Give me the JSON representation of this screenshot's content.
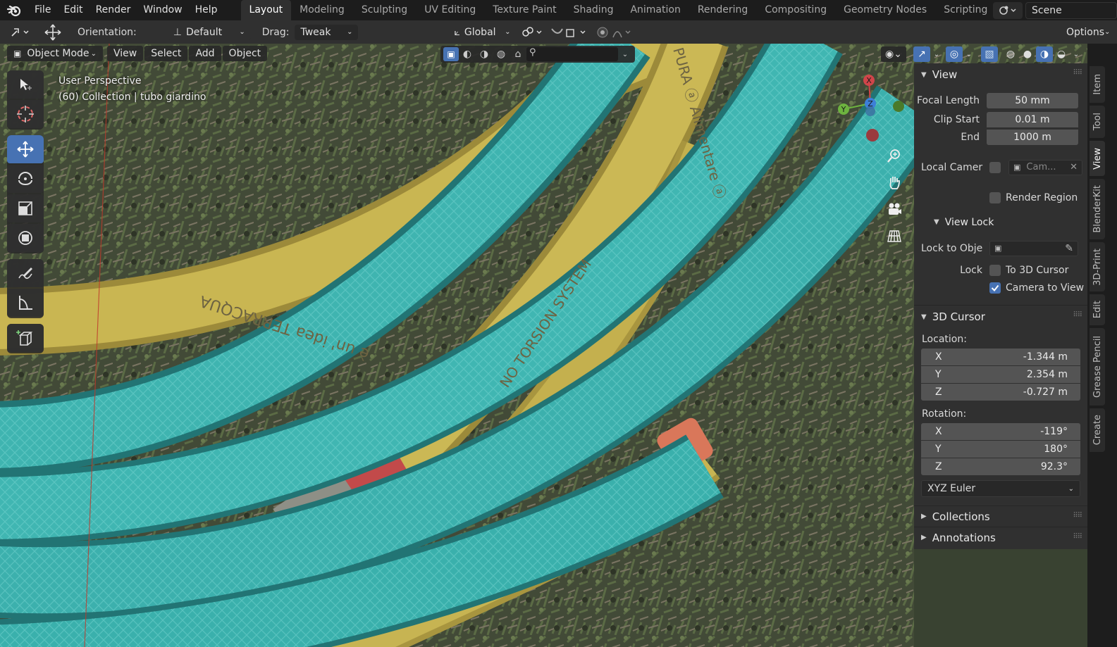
{
  "menu": [
    "File",
    "Edit",
    "Render",
    "Window",
    "Help"
  ],
  "workspaces": [
    "Layout",
    "Modeling",
    "Sculpting",
    "UV Editing",
    "Texture Paint",
    "Shading",
    "Animation",
    "Rendering",
    "Compositing",
    "Geometry Nodes",
    "Scripting"
  ],
  "active_workspace": "Layout",
  "scene_name": "Scene",
  "tool_header": {
    "orientation_label": "Orientation:",
    "orientation_value": "Default",
    "drag_label": "Drag:",
    "drag_value": "Tweak",
    "transform_orientation": "Global",
    "options": "Options"
  },
  "viewport_header": {
    "mode": "Object Mode",
    "view": "View",
    "select": "Select",
    "add": "Add",
    "object": "Object"
  },
  "overlay": {
    "perspective": "User Perspective",
    "collection": "(60) Collection | tubo giardino"
  },
  "gizmo": {
    "x": "X",
    "y": "Y",
    "z": "Z"
  },
  "npanel": {
    "view_title": "View",
    "focal_length_label": "Focal Length",
    "focal_length": "50 mm",
    "clip_start_label": "Clip Start",
    "clip_start": "0.01 m",
    "end_label": "End",
    "clip_end": "1000 m",
    "local_camera_label": "Local Camer",
    "local_camera_value": "Cam...",
    "render_region": "Render Region",
    "view_lock_title": "View Lock",
    "lock_to_object_label": "Lock to Obje",
    "lock_label": "Lock",
    "to_3d_cursor": "To 3D Cursor",
    "camera_to_view": "Camera to View",
    "cursor_title": "3D Cursor",
    "location_label": "Location:",
    "location": {
      "x_label": "X",
      "x": "-1.344 m",
      "y_label": "Y",
      "y": "2.354 m",
      "z_label": "Z",
      "z": "-0.727 m"
    },
    "rotation_label": "Rotation:",
    "rotation": {
      "x_label": "X",
      "x": "-119°",
      "y_label": "Y",
      "y": "180°",
      "z_label": "Z",
      "z": "92.3°"
    },
    "rotation_mode": "XYZ Euler",
    "collections_title": "Collections",
    "annotations_title": "Annotations"
  },
  "side_tabs": [
    "Item",
    "Tool",
    "View",
    "BlenderKit",
    "3D-Print",
    "Edit",
    "Grease Pencil",
    "Create"
  ],
  "active_side_tab": "View",
  "colors": {
    "accent": "#4772b3",
    "panel": "#303030",
    "header": "#1c1c1c",
    "hose_teal": "#3bb5b0",
    "hose_yellow": "#c8b450"
  },
  "hose_print": {
    "text1": "è un' idea TERRACQUA",
    "text2": "NO TORSION SYSTEM",
    "text3": "PURA ⓐ Alimentare ⓐ"
  }
}
